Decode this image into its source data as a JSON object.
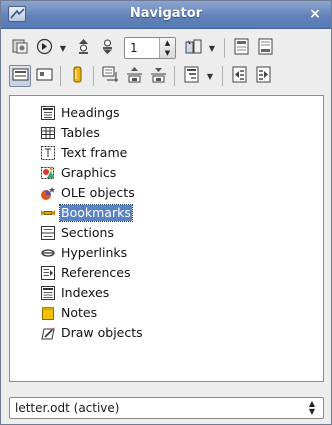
{
  "window": {
    "title": "Navigator",
    "close_glyph": "×"
  },
  "toolbar": {
    "page_number": "1",
    "row1": [
      {
        "name": "content-view-icon"
      },
      {
        "name": "navigation-icon",
        "has_dropdown": true
      },
      {
        "name": "previous-object-icon"
      },
      {
        "name": "next-object-icon"
      },
      {
        "name": "page-number-field"
      },
      {
        "name": "drag-mode-icon",
        "has_dropdown": true
      },
      {
        "name": "header-icon"
      },
      {
        "name": "footer-icon"
      }
    ],
    "row2": [
      {
        "name": "list-box-toggle-icon",
        "active": true
      },
      {
        "name": "content-toggle-icon"
      },
      {
        "name": "reminder-icon"
      },
      {
        "name": "anchor-icon"
      },
      {
        "name": "promote-chapter-icon"
      },
      {
        "name": "demote-chapter-icon"
      },
      {
        "name": "heading-levels-icon",
        "has_dropdown": true
      },
      {
        "name": "promote-level-icon"
      },
      {
        "name": "demote-level-icon"
      }
    ]
  },
  "tree": {
    "items": [
      {
        "label": "Headings",
        "icon": "headings-icon"
      },
      {
        "label": "Tables",
        "icon": "tables-icon"
      },
      {
        "label": "Text frame",
        "icon": "text-frame-icon"
      },
      {
        "label": "Graphics",
        "icon": "graphics-icon"
      },
      {
        "label": "OLE objects",
        "icon": "ole-objects-icon"
      },
      {
        "label": "Bookmarks",
        "icon": "bookmarks-icon",
        "selected": true
      },
      {
        "label": "Sections",
        "icon": "sections-icon"
      },
      {
        "label": "Hyperlinks",
        "icon": "hyperlinks-icon"
      },
      {
        "label": "References",
        "icon": "references-icon"
      },
      {
        "label": "Indexes",
        "icon": "indexes-icon"
      },
      {
        "label": "Notes",
        "icon": "notes-icon"
      },
      {
        "label": "Draw objects",
        "icon": "draw-objects-icon"
      }
    ]
  },
  "document_selector": {
    "value": "letter.odt (active)"
  },
  "colors": {
    "titlebar": "#6382b9",
    "selection": "#5a82c2"
  }
}
